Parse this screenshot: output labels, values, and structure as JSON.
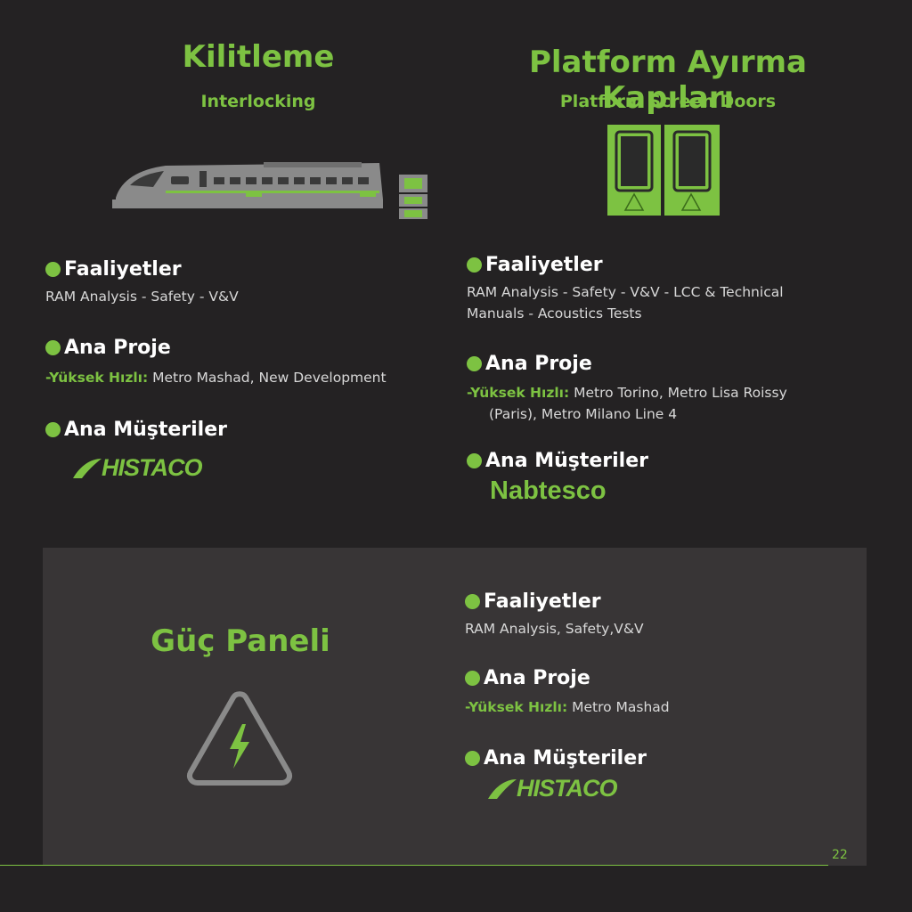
{
  "left": {
    "title": "Kilitleme",
    "subtitle": "Interlocking",
    "activities": {
      "heading": "Faaliyetler",
      "text": "RAM Analysis - Safety - V&V"
    },
    "project": {
      "heading": "Ana Proje",
      "prefix": "-Yüksek Hızlı:",
      "text": " Metro Mashad, New Development"
    },
    "customers": {
      "heading": "Ana Müşteriler",
      "logo": "HISTACO"
    }
  },
  "right": {
    "title": "Platform Ayırma Kapıları",
    "subtitle": "Platform Screen Doors",
    "activities": {
      "heading": "Faaliyetler",
      "text_line1": "RAM Analysis - Safety - V&V - LCC & Technical",
      "text_line2": "Manuals - Acoustics Tests"
    },
    "project": {
      "heading": "Ana Proje",
      "prefix": "-Yüksek Hızlı:",
      "text_line1": " Metro Torino, Metro Lisa Roissy",
      "text_line2": "(Paris), Metro Milano Line 4"
    },
    "customers": {
      "heading": "Ana Müşteriler",
      "logo": "Nabtesco"
    }
  },
  "bottom": {
    "title": "Güç Paneli",
    "activities": {
      "heading": "Faaliyetler",
      "text": "RAM Analysis, Safety,V&V"
    },
    "project": {
      "heading": "Ana Proje",
      "prefix": "-Yüksek Hızlı:",
      "text": " Metro Mashad"
    },
    "customers": {
      "heading": "Ana Müşteriler",
      "logo": "HISTACO"
    }
  },
  "page_number": "22",
  "icons": [
    "train-icon",
    "signal-box-icon",
    "screen-doors-icon",
    "high-voltage-icon",
    "histaco-logo",
    "nabtesco-logo"
  ],
  "colors": {
    "accent": "#7dc242",
    "background": "#242223",
    "panel": "#383536",
    "icon_gray": "#8a8a8a"
  }
}
